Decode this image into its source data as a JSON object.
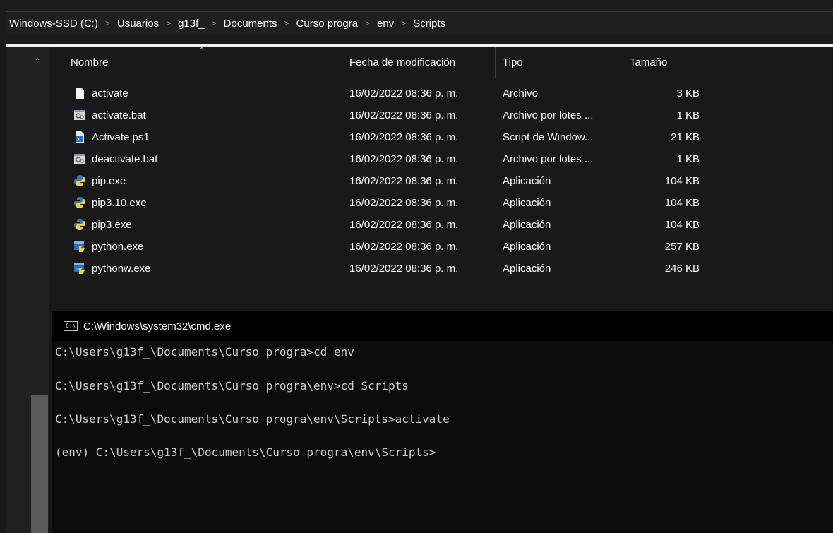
{
  "breadcrumb": {
    "items": [
      "Windows-SSD (C:)",
      "Usuarios",
      "g13f_",
      "Documents",
      "Curso progra",
      "env",
      "Scripts"
    ],
    "separator": ">"
  },
  "file_list": {
    "columns": {
      "name": "Nombre",
      "modified": "Fecha de modificación",
      "type": "Tipo",
      "size": "Tamaño"
    },
    "rows": [
      {
        "name": "activate",
        "modified": "16/02/2022 08:36 p. m.",
        "type": "Archivo",
        "size": "3 KB",
        "icon": "file-icon"
      },
      {
        "name": "activate.bat",
        "modified": "16/02/2022 08:36 p. m.",
        "type": "Archivo por lotes ...",
        "size": "1 KB",
        "icon": "batch-file-icon"
      },
      {
        "name": "Activate.ps1",
        "modified": "16/02/2022 08:36 p. m.",
        "type": "Script de Window...",
        "size": "21 KB",
        "icon": "powershell-icon"
      },
      {
        "name": "deactivate.bat",
        "modified": "16/02/2022 08:36 p. m.",
        "type": "Archivo por lotes ...",
        "size": "1 KB",
        "icon": "batch-file-icon"
      },
      {
        "name": "pip.exe",
        "modified": "16/02/2022 08:36 p. m.",
        "type": "Aplicación",
        "size": "104 KB",
        "icon": "python-icon"
      },
      {
        "name": "pip3.10.exe",
        "modified": "16/02/2022 08:36 p. m.",
        "type": "Aplicación",
        "size": "104 KB",
        "icon": "python-icon"
      },
      {
        "name": "pip3.exe",
        "modified": "16/02/2022 08:36 p. m.",
        "type": "Aplicación",
        "size": "104 KB",
        "icon": "python-icon"
      },
      {
        "name": "python.exe",
        "modified": "16/02/2022 08:36 p. m.",
        "type": "Aplicación",
        "size": "257 KB",
        "icon": "python-exe-icon"
      },
      {
        "name": "pythonw.exe",
        "modified": "16/02/2022 08:36 p. m.",
        "type": "Aplicación",
        "size": "246 KB",
        "icon": "pythonw-exe-icon"
      }
    ]
  },
  "cmd": {
    "title": "C:\\Windows\\system32\\cmd.exe",
    "icon_text": "C:\\.",
    "lines": [
      "C:\\Users\\g13f_\\Documents\\Curso progra>cd env",
      "C:\\Users\\g13f_\\Documents\\Curso progra\\env>cd Scripts",
      "C:\\Users\\g13f_\\Documents\\Curso progra\\env\\Scripts>activate",
      "(env) C:\\Users\\g13f_\\Documents\\Curso progra\\env\\Scripts>"
    ]
  },
  "colors": {
    "background": "#191919",
    "cmd_background": "#0c0c0c",
    "cmd_text": "#cccccc"
  }
}
